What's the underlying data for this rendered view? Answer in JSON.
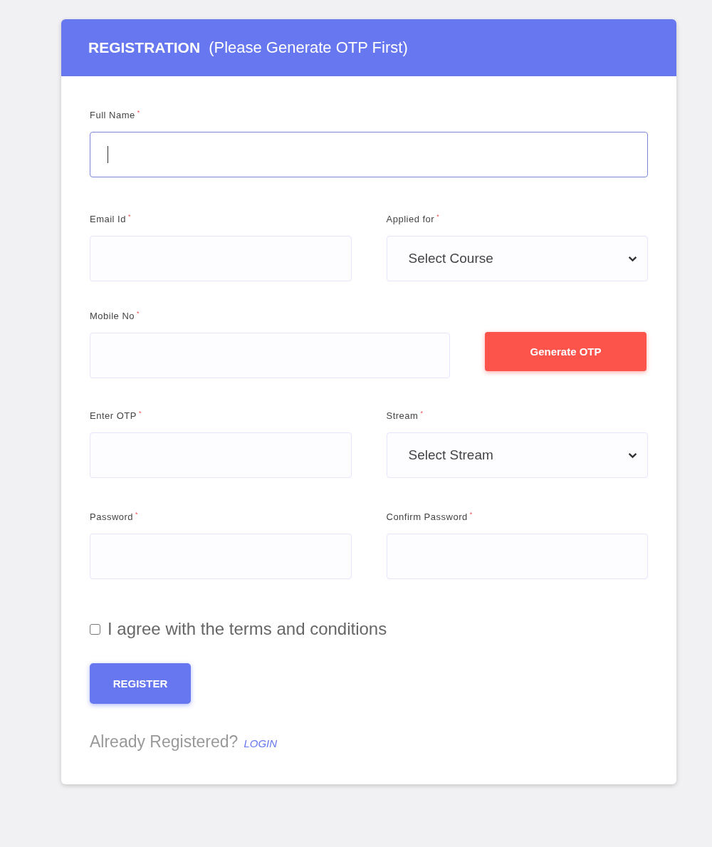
{
  "header": {
    "title": "REGISTRATION",
    "subtitle": "(Please Generate OTP First)"
  },
  "rows": [
    {
      "fields": [
        {
          "kind": "input",
          "label": "Full Name",
          "required_mark": "*",
          "focused": true
        }
      ]
    },
    {
      "fields": [
        {
          "kind": "input",
          "label": "Email Id",
          "required_mark": "*",
          "focused": false
        },
        {
          "kind": "select",
          "label": "Applied for",
          "required_mark": "*",
          "value": "Select Course"
        }
      ]
    },
    {
      "fields": [
        {
          "kind": "input",
          "label": "Mobile No",
          "required_mark": "*",
          "focused": false
        },
        {
          "kind": "button",
          "text": "Generate OTP"
        }
      ]
    },
    {
      "fields": [
        {
          "kind": "input",
          "label": "Enter OTP",
          "required_mark": "*",
          "focused": false
        },
        {
          "kind": "select",
          "label": "Stream",
          "required_mark": "*",
          "value": "Select Stream"
        }
      ]
    },
    {
      "fields": [
        {
          "kind": "input",
          "label": "Password",
          "required_mark": "*",
          "focused": false
        },
        {
          "kind": "input",
          "label": "Confirm Password",
          "required_mark": "*",
          "focused": false
        }
      ]
    }
  ],
  "agree": {
    "label": "I agree with the terms and conditions",
    "checked": false
  },
  "register_button": "REGISTER",
  "footer": {
    "text": "Already Registered?",
    "link": "LOGIN"
  }
}
